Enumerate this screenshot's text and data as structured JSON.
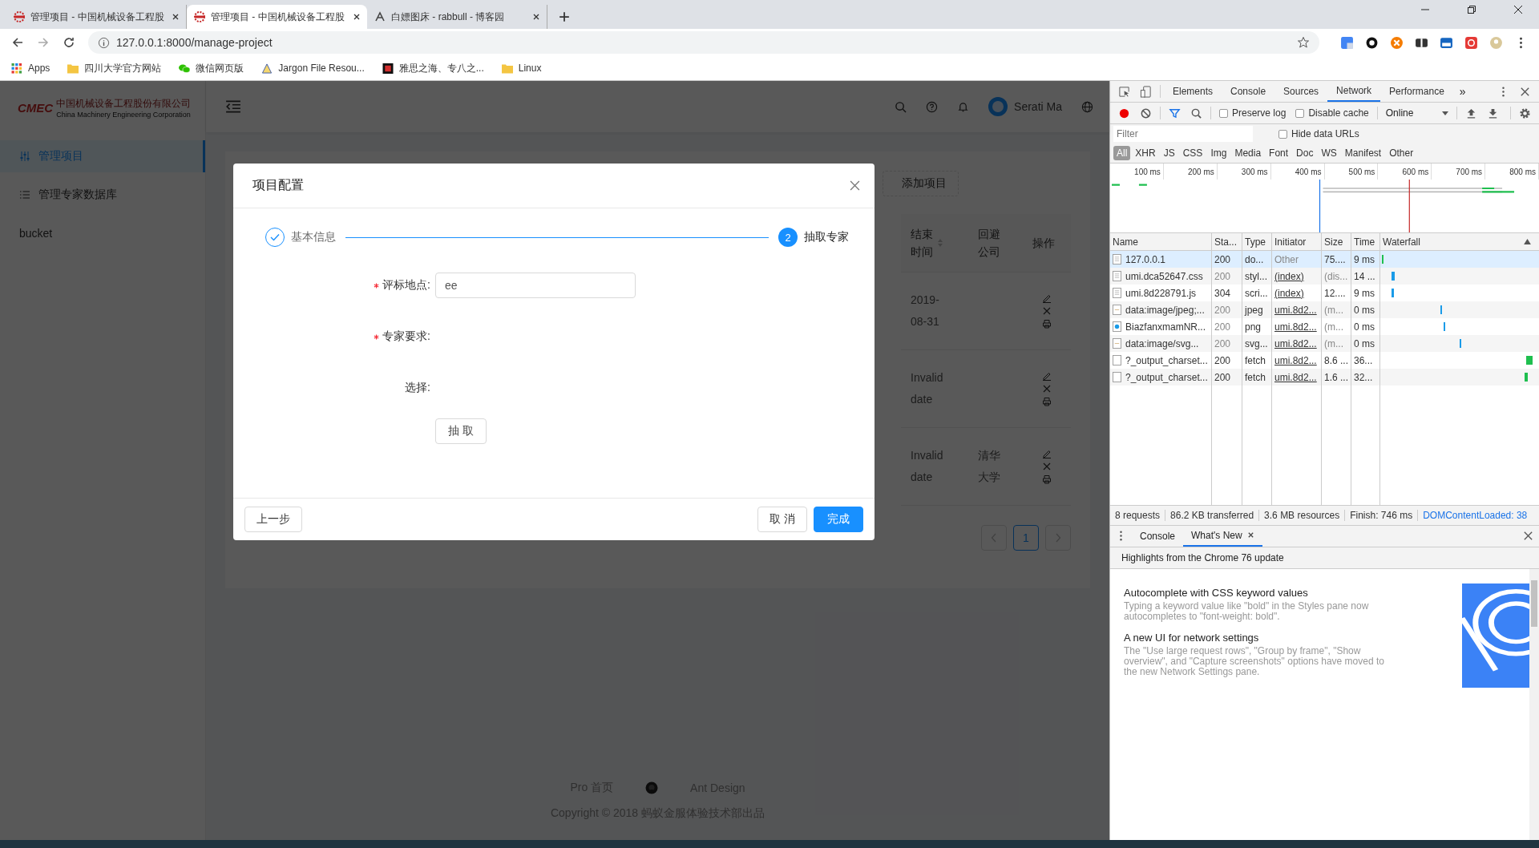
{
  "browser": {
    "tabs": [
      {
        "title": "管理项目 - 中国机械设备工程股",
        "selected": false,
        "kind": "cmec"
      },
      {
        "title": "管理项目 - 中国机械设备工程股",
        "selected": true,
        "kind": "cmec"
      },
      {
        "title": "白嫖图床 - rabbull - 博客园",
        "selected": false,
        "kind": "blog"
      }
    ],
    "url": "127.0.0.1:8000/manage-project",
    "bookmarks": [
      {
        "label": "Apps",
        "kind": "apps"
      },
      {
        "label": "四川大学官方网站",
        "kind": "folder"
      },
      {
        "label": "微信网页版",
        "kind": "wechat"
      },
      {
        "label": "Jargon File Resou...",
        "kind": "jargon"
      },
      {
        "label": "雅思之海、专八之...",
        "kind": "red"
      },
      {
        "label": "Linux",
        "kind": "folder"
      }
    ]
  },
  "app": {
    "logo": {
      "mark": "CMEC",
      "cn": "中国机械设备工程股份有限公司",
      "en": "China Machinery Engineering Corporation"
    },
    "user": "Serati Ma",
    "sidebar": [
      {
        "label": "管理项目",
        "selected": true,
        "kind": "sliders"
      },
      {
        "label": "管理专家数据库",
        "selected": false,
        "kind": "list"
      },
      {
        "label": "bucket",
        "selected": false,
        "kind": "plain"
      }
    ],
    "add_button": "添加项目",
    "table": {
      "columns": [
        {
          "label": "结束时间",
          "sortable": true
        },
        {
          "label": "回避公司",
          "sortable": false
        },
        {
          "label": "操作",
          "sortable": false
        }
      ],
      "rows": [
        {
          "end": "2019-08-31"
        },
        {
          "end": "Invalid date"
        },
        {
          "end": "Invalid date",
          "avoid": "清华大学"
        }
      ]
    },
    "pagination": {
      "page": "1"
    },
    "footer": {
      "links": [
        "Pro 首页",
        "Ant Design"
      ],
      "copyright": "Copyright © 2018 蚂蚁金服体验技术部出品"
    }
  },
  "modal": {
    "title": "项目配置",
    "steps": [
      {
        "label": "基本信息",
        "kind": "done"
      },
      {
        "label": "抽取专家",
        "kind": "current",
        "number": "2"
      }
    ],
    "fields": [
      {
        "label": "评标地点:",
        "required": true,
        "kind": "input",
        "value": "ee"
      },
      {
        "label": "专家要求:",
        "required": true,
        "kind": "empty"
      },
      {
        "label": "选择:",
        "required": false,
        "kind": "empty"
      }
    ],
    "draw_button": "抽 取",
    "prev_button": "上一步",
    "cancel_button": "取 消",
    "ok_button": "完成"
  },
  "devtools": {
    "tabs": [
      {
        "label": "Elements",
        "selected": false
      },
      {
        "label": "Console",
        "selected": false
      },
      {
        "label": "Sources",
        "selected": false
      },
      {
        "label": "Network",
        "selected": true
      },
      {
        "label": "Performance",
        "selected": false
      }
    ],
    "more": "»",
    "preserve_log": {
      "label": "Preserve log",
      "checked": false
    },
    "disable_cache": {
      "label": "Disable cache",
      "checked": false
    },
    "throttle": "Online",
    "filter_placeholder": "Filter",
    "hide_data_urls": {
      "label": "Hide data URLs",
      "checked": false
    },
    "types": [
      {
        "label": "All",
        "selected": true
      },
      {
        "label": "XHR",
        "selected": false
      },
      {
        "label": "JS",
        "selected": false
      },
      {
        "label": "CSS",
        "selected": false
      },
      {
        "label": "Img",
        "selected": false
      },
      {
        "label": "Media",
        "selected": false
      },
      {
        "label": "Font",
        "selected": false
      },
      {
        "label": "Doc",
        "selected": false
      },
      {
        "label": "WS",
        "selected": false
      },
      {
        "label": "Manifest",
        "selected": false
      },
      {
        "label": "Other",
        "selected": false
      }
    ],
    "timeline_ticks": [
      "100 ms",
      "200 ms",
      "300 ms",
      "400 ms",
      "500 ms",
      "600 ms",
      "700 ms",
      "800 ms"
    ],
    "columns": [
      "Name",
      "Sta...",
      "Type",
      "Initiator",
      "Size",
      "Time",
      "Waterfall"
    ],
    "requests": [
      {
        "name": "127.0.0.1",
        "status": "200",
        "type": "do...",
        "initiator": "Other",
        "initiator_link": false,
        "size": "75....",
        "time": "9 ms",
        "selected": true,
        "dimmed": false,
        "kind": "doc"
      },
      {
        "name": "umi.dca52647.css",
        "status": "200",
        "type": "styl...",
        "initiator": "(index)",
        "initiator_link": true,
        "size": "(dis...",
        "time": "14 ...",
        "selected": false,
        "dimmed": true,
        "kind": "doc"
      },
      {
        "name": "umi.8d228791.js",
        "status": "304",
        "type": "scri...",
        "initiator": "(index)",
        "initiator_link": true,
        "size": "12....",
        "time": "9 ms",
        "selected": false,
        "dimmed": false,
        "kind": "doc"
      },
      {
        "name": "data:image/jpeg;...",
        "status": "200",
        "type": "jpeg",
        "initiator": "umi.8d2...",
        "initiator_link": true,
        "size": "(m...",
        "time": "0 ms",
        "selected": false,
        "dimmed": true,
        "kind": "image"
      },
      {
        "name": "BiazfanxmamNR...",
        "status": "200",
        "type": "png",
        "initiator": "umi.8d2...",
        "initiator_link": true,
        "size": "(m...",
        "time": "0 ms",
        "selected": false,
        "dimmed": true,
        "kind": "png"
      },
      {
        "name": "data:image/svg...",
        "status": "200",
        "type": "svg...",
        "initiator": "umi.8d2...",
        "initiator_link": true,
        "size": "(m...",
        "time": "0 ms",
        "selected": false,
        "dimmed": true,
        "kind": "image"
      },
      {
        "name": "?_output_charset...",
        "status": "200",
        "type": "fetch",
        "initiator": "umi.8d2...",
        "initiator_link": true,
        "size": "8.6 ...",
        "time": "36...",
        "selected": false,
        "dimmed": false,
        "kind": "blank"
      },
      {
        "name": "?_output_charset...",
        "status": "200",
        "type": "fetch",
        "initiator": "umi.8d2...",
        "initiator_link": true,
        "size": "1.6 ...",
        "time": "32...",
        "selected": false,
        "dimmed": false,
        "kind": "blank"
      }
    ],
    "summary": [
      {
        "text": "8 requests",
        "kind": "plain"
      },
      {
        "text": "86.2 KB transferred",
        "kind": "plain"
      },
      {
        "text": "3.6 MB resources",
        "kind": "plain"
      },
      {
        "text": "Finish: 746 ms",
        "kind": "plain"
      },
      {
        "text": "DOMContentLoaded: 38",
        "kind": "blue"
      }
    ],
    "drawer_tabs": [
      {
        "label": "Console",
        "selected": false,
        "closable": false
      },
      {
        "label": "What's New",
        "selected": true,
        "closable": true
      }
    ],
    "highlights_title": "Highlights from the Chrome 76 update",
    "articles": [
      {
        "title": "Autocomplete with CSS keyword values",
        "body": "Typing a keyword value like \"bold\" in the Styles pane now autocompletes to \"font-weight: bold\"."
      },
      {
        "title": "A new UI for network settings",
        "body": "The \"Use large request rows\", \"Group by frame\", \"Show overview\", and \"Capture screenshots\" options have moved to the new Network Settings pane."
      }
    ]
  }
}
